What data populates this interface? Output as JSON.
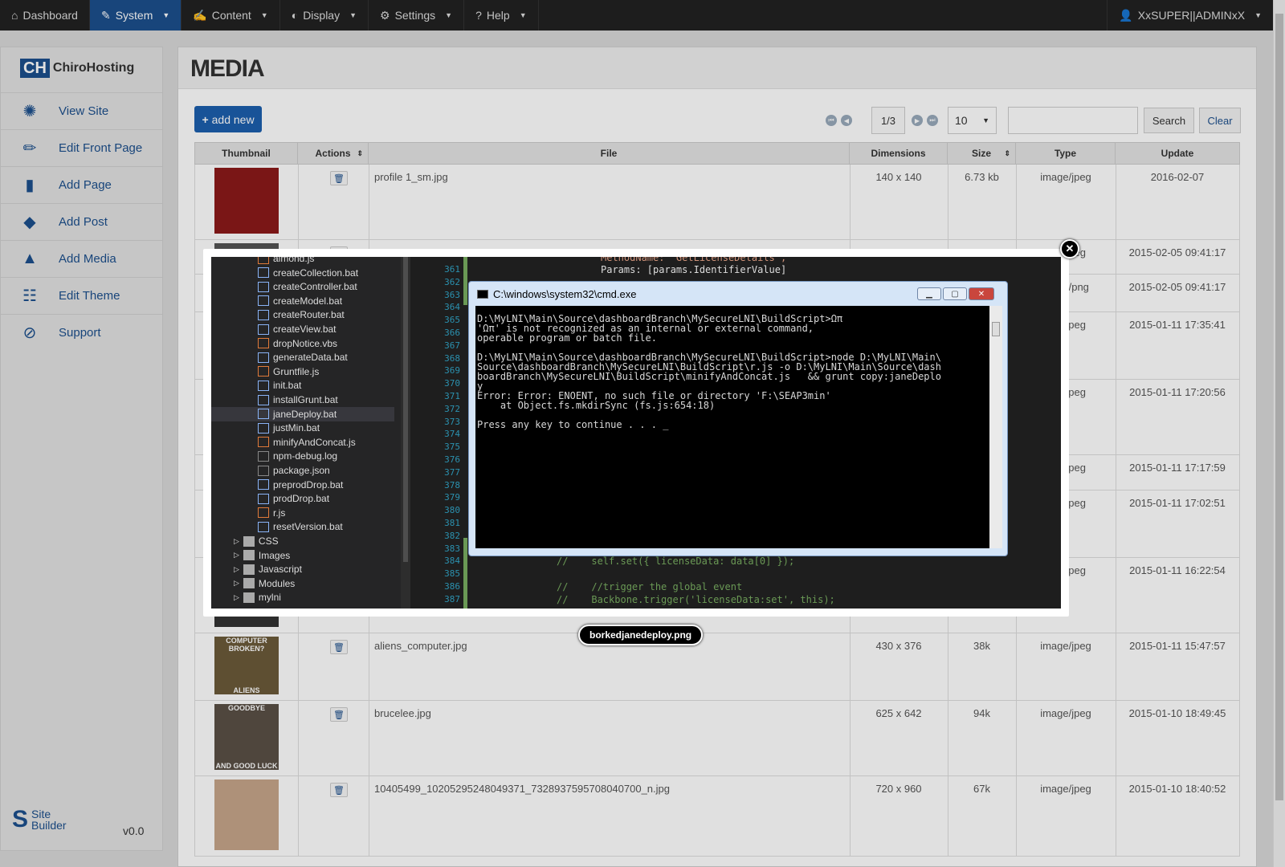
{
  "topnav": {
    "items": [
      {
        "label": "Dashboard",
        "icon": "home-icon",
        "active": false
      },
      {
        "label": "System",
        "icon": "wrench-icon",
        "active": true
      },
      {
        "label": "Content",
        "icon": "edit-icon",
        "active": false
      },
      {
        "label": "Display",
        "icon": "contrast-icon",
        "active": false
      },
      {
        "label": "Settings",
        "icon": "gear-icon",
        "active": false
      },
      {
        "label": "Help",
        "icon": "question-icon",
        "active": false
      }
    ],
    "user": "XxSUPER||ADMINxX"
  },
  "sidebar": {
    "brand_mark": "CH",
    "brand_name": "ChiroHosting",
    "items": [
      {
        "label": "View Site",
        "icon": "aperture-icon"
      },
      {
        "label": "Edit Front Page",
        "icon": "pencil-icon"
      },
      {
        "label": "Add Page",
        "icon": "file-icon"
      },
      {
        "label": "Add Post",
        "icon": "tag-icon"
      },
      {
        "label": "Add Media",
        "icon": "chart-icon"
      },
      {
        "label": "Edit Theme",
        "icon": "sliders-icon"
      },
      {
        "label": "Support",
        "icon": "compass-icon"
      }
    ],
    "footer_brand_line1": "Site",
    "footer_brand_line2": "Builder",
    "version": "v0.0"
  },
  "main": {
    "title": "MEDIA",
    "add_new_label": "add new",
    "pager": {
      "current": "1/3",
      "page_size": "10"
    },
    "search_label": "Search",
    "clear_label": "Clear",
    "columns": [
      "Thumbnail",
      "Actions",
      "File",
      "Dimensions",
      "Size",
      "Type",
      "Update"
    ],
    "rows": [
      {
        "file": "profile 1_sm.jpg",
        "dimensions": "140 x 140",
        "size": "6.73 kb",
        "type": "image/jpeg",
        "update": "2016-02-07"
      },
      {
        "file": "",
        "dimensions": "",
        "size": "",
        "type": "age/jpeg",
        "update": "2015-02-05 09:41:17"
      },
      {
        "file": "",
        "dimensions": "",
        "size": "",
        "type": "mage/png",
        "update": "2015-02-05 09:41:17"
      },
      {
        "file": "",
        "dimensions": "",
        "size": "",
        "type": "age/jpeg",
        "update": "2015-01-11 17:35:41"
      },
      {
        "file": "",
        "dimensions": "",
        "size": "",
        "type": "age/jpeg",
        "update": "2015-01-11 17:20:56"
      },
      {
        "file": "",
        "dimensions": "",
        "size": "",
        "type": "age/jpeg",
        "update": "2015-01-11 17:17:59"
      },
      {
        "file": "",
        "dimensions": "",
        "size": "",
        "type": "age/jpeg",
        "update": "2015-01-11 17:02:51"
      },
      {
        "file": "",
        "dimensions": "",
        "size": "",
        "type": "age/jpeg",
        "update": "2015-01-11 16:22:54"
      },
      {
        "file": "aliens_computer.jpg",
        "dimensions": "430 x 376",
        "size": "38k",
        "type": "image/jpeg",
        "update": "2015-01-11 15:47:57",
        "thumb_top": "COMPUTER BROKEN?",
        "thumb_bottom": "ALIENS"
      },
      {
        "file": "brucelee.jpg",
        "dimensions": "625 x 642",
        "size": "94k",
        "type": "image/jpeg",
        "update": "2015-01-10 18:49:45",
        "thumb_top": "GOODBYE",
        "thumb_bottom": "AND GOOD LUCK"
      },
      {
        "file": "10405499_10205295248049371_7328937595708040700_n.jpg",
        "dimensions": "720 x 960",
        "size": "67k",
        "type": "image/jpeg",
        "update": "2015-01-10 18:40:52"
      }
    ]
  },
  "lightbox": {
    "caption": "borkedjanedeploy.png",
    "explorer_files": [
      {
        "name": "almond.js",
        "kind": "js"
      },
      {
        "name": "createCollection.bat",
        "kind": "bat"
      },
      {
        "name": "createController.bat",
        "kind": "bat"
      },
      {
        "name": "createModel.bat",
        "kind": "bat"
      },
      {
        "name": "createRouter.bat",
        "kind": "bat"
      },
      {
        "name": "createView.bat",
        "kind": "bat"
      },
      {
        "name": "dropNotice.vbs",
        "kind": "js"
      },
      {
        "name": "generateData.bat",
        "kind": "bat"
      },
      {
        "name": "Gruntfile.js",
        "kind": "js"
      },
      {
        "name": "init.bat",
        "kind": "bat"
      },
      {
        "name": "installGrunt.bat",
        "kind": "bat"
      },
      {
        "name": "janeDeploy.bat",
        "kind": "bat"
      },
      {
        "name": "justMin.bat",
        "kind": "bat"
      },
      {
        "name": "minifyAndConcat.js",
        "kind": "js"
      },
      {
        "name": "npm-debug.log",
        "kind": "txt"
      },
      {
        "name": "package.json",
        "kind": "txt"
      },
      {
        "name": "preprodDrop.bat",
        "kind": "bat"
      },
      {
        "name": "prodDrop.bat",
        "kind": "bat"
      },
      {
        "name": "r.js",
        "kind": "js"
      },
      {
        "name": "resetVersion.bat",
        "kind": "bat"
      }
    ],
    "explorer_folders": [
      "CSS",
      "Images",
      "Javascript",
      "Modules",
      "mylni"
    ],
    "line_numbers": [
      "361",
      "362",
      "363",
      "364",
      "365",
      "366",
      "367",
      "368",
      "369",
      "370",
      "371",
      "372",
      "373",
      "374",
      "375",
      "376",
      "377",
      "378",
      "379",
      "380",
      "381",
      "382",
      "383",
      "384",
      "385",
      "386",
      "387"
    ],
    "code_lines": [
      "MethodName: 'GetLicenseDetails',",
      "Params: [params.IdentifierValue]",
      "//    self.set({ licenseData: data[0] });",
      "//    //trigger the global event",
      "//    Backbone.trigger('licenseData:set', this);"
    ],
    "cmd_title": "C:\\windows\\system32\\cmd.exe",
    "cmd_output": "D:\\MyLNI\\Main\\Source\\dashboardBranch\\MySecureLNI\\BuildScript>Ωπ\n'Ωπ' is not recognized as an internal or external command,\noperable program or batch file.\n\nD:\\MyLNI\\Main\\Source\\dashboardBranch\\MySecureLNI\\BuildScript>node D:\\MyLNI\\Main\\\nSource\\dashboardBranch\\MySecureLNI\\BuildScript\\r.js -o D:\\MyLNI\\Main\\Source\\dash\nboardBranch\\MySecureLNI\\BuildScript\\minifyAndConcat.js   && grunt copy:janeDeplo\ny\nError: Error: ENOENT, no such file or directory 'F:\\SEAP3min'\n    at Object.fs.mkdirSync (fs.js:654:18)\n\nPress any key to continue . . . _"
  },
  "colors": {
    "brand": "#1c4f8c",
    "nav_bg": "#222222",
    "button": "#1c5fae"
  }
}
